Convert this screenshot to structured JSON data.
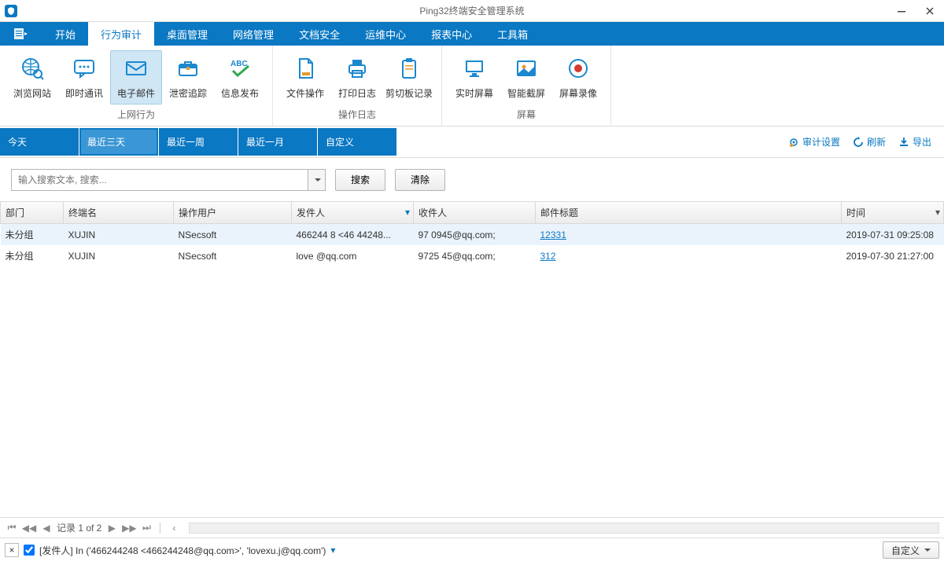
{
  "title": "Ping32终端安全管理系统",
  "menuTabs": [
    "开始",
    "行为审计",
    "桌面管理",
    "网络管理",
    "文档安全",
    "运维中心",
    "报表中心",
    "工具箱"
  ],
  "menuActive": 1,
  "ribbonGroups": [
    {
      "label": "上网行为",
      "items": [
        {
          "id": "browse-site",
          "label": "浏览网站"
        },
        {
          "id": "im",
          "label": "即时通讯"
        },
        {
          "id": "email",
          "label": "电子邮件",
          "active": true
        },
        {
          "id": "leak-trace",
          "label": "泄密追踪"
        },
        {
          "id": "info-pub",
          "label": "信息发布"
        }
      ]
    },
    {
      "label": "操作日志",
      "items": [
        {
          "id": "file-op",
          "label": "文件操作"
        },
        {
          "id": "print-log",
          "label": "打印日志"
        },
        {
          "id": "clipboard",
          "label": "剪切板记录"
        }
      ]
    },
    {
      "label": "屏幕",
      "items": [
        {
          "id": "live-screen",
          "label": "实时屏幕"
        },
        {
          "id": "smart-shot",
          "label": "智能截屏"
        },
        {
          "id": "screen-rec",
          "label": "屏幕录像"
        }
      ]
    }
  ],
  "timeFilters": [
    "今天",
    "最近三天",
    "最近一周",
    "最近一月",
    "自定义"
  ],
  "timeActive": 1,
  "actions": {
    "audit": "审计设置",
    "refresh": "刷新",
    "export": "导出"
  },
  "search": {
    "placeholder": "输入搜索文本, 搜索...",
    "searchBtn": "搜索",
    "clearBtn": "清除"
  },
  "columns": [
    "部门",
    "终端名",
    "操作用户",
    "发件人",
    "收件人",
    "邮件标题",
    "时间"
  ],
  "rows": [
    {
      "dept": "未分组",
      "host": "XUJIN",
      "user": "NSecsoft",
      "from": "466244   8 <46   44248...",
      "to": "97    0945@qq.com;",
      "subject": "12331",
      "time": "2019-07-31 09:25:08"
    },
    {
      "dept": "未分组",
      "host": "XUJIN",
      "user": "NSecsoft",
      "from": "love     @qq.com",
      "to": "9725   45@qq.com;",
      "subject": "312",
      "time": "2019-07-30 21:27:00"
    }
  ],
  "pager": {
    "text": "记录 1 of 2"
  },
  "filter": {
    "text": "[发件人] In ('466244248 <466244248@qq.com>', 'lovexu.j@qq.com')",
    "btn": "自定义"
  }
}
